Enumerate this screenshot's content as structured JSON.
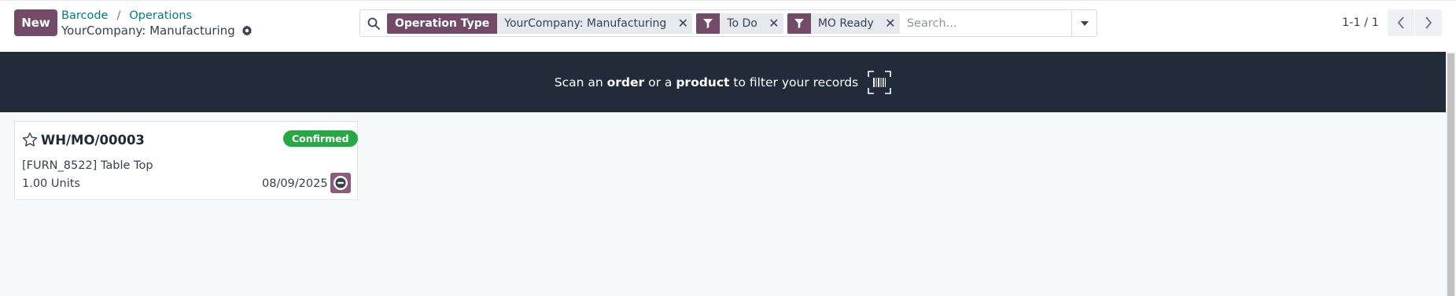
{
  "toolbar": {
    "new_label": "New"
  },
  "breadcrumb": {
    "items": [
      "Barcode",
      "Operations"
    ],
    "separator": "/"
  },
  "page": {
    "title": "YourCompany: Manufacturing"
  },
  "search": {
    "facets": [
      {
        "type": "group",
        "label": "Operation Type",
        "value": "YourCompany: Manufacturing"
      },
      {
        "type": "filter",
        "icon": "filter-icon",
        "value": "To Do"
      },
      {
        "type": "filter",
        "icon": "filter-icon",
        "value": "MO Ready"
      }
    ],
    "placeholder": "Search..."
  },
  "pager": {
    "text": "1-1 / 1"
  },
  "banner": {
    "prefix": "Scan an ",
    "bold1": "order",
    "middle": " or a ",
    "bold2": "product",
    "suffix": " to filter your records",
    "icon": "barcode-scan-icon"
  },
  "records": [
    {
      "reference": "WH/MO/00003",
      "status": "Confirmed",
      "product": "[FURN_8522] Table Top",
      "quantity": "1.00 Units",
      "date": "08/09/2025"
    }
  ],
  "colors": {
    "brand": "#714B67",
    "banner_bg": "#212b3a",
    "link": "#017e84",
    "status_confirmed": "#28a745"
  }
}
